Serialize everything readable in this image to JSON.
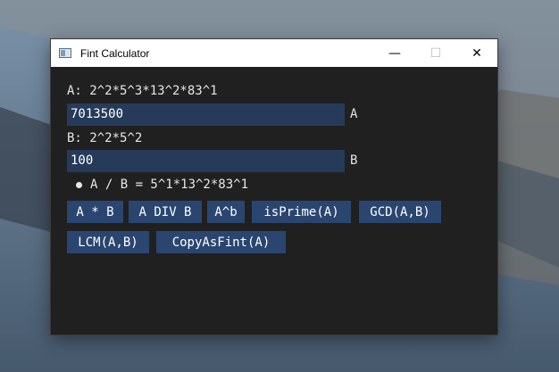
{
  "window": {
    "title": "Fint Calculator",
    "controls": {
      "minimize": "—",
      "maximize": "☐",
      "close": "✕"
    }
  },
  "a": {
    "label": "A: 2^2*5^3*13^2*83^1",
    "value": "7013500",
    "tag": "A"
  },
  "b": {
    "label": "B: 2^2*5^2",
    "value": "100",
    "tag": "B"
  },
  "result": {
    "text": "A / B = 5^1*13^2*83^1"
  },
  "buttons": [
    "A * B",
    "A DIV B",
    "A^b",
    "isPrime(A)",
    "GCD(A,B)",
    "LCM(A,B)",
    "CopyAsFint(A)"
  ],
  "colors": {
    "window_bg": "#202020",
    "input_bg": "#263b5a",
    "button_bg": "#2a4670",
    "text": "#e6e6e6"
  }
}
